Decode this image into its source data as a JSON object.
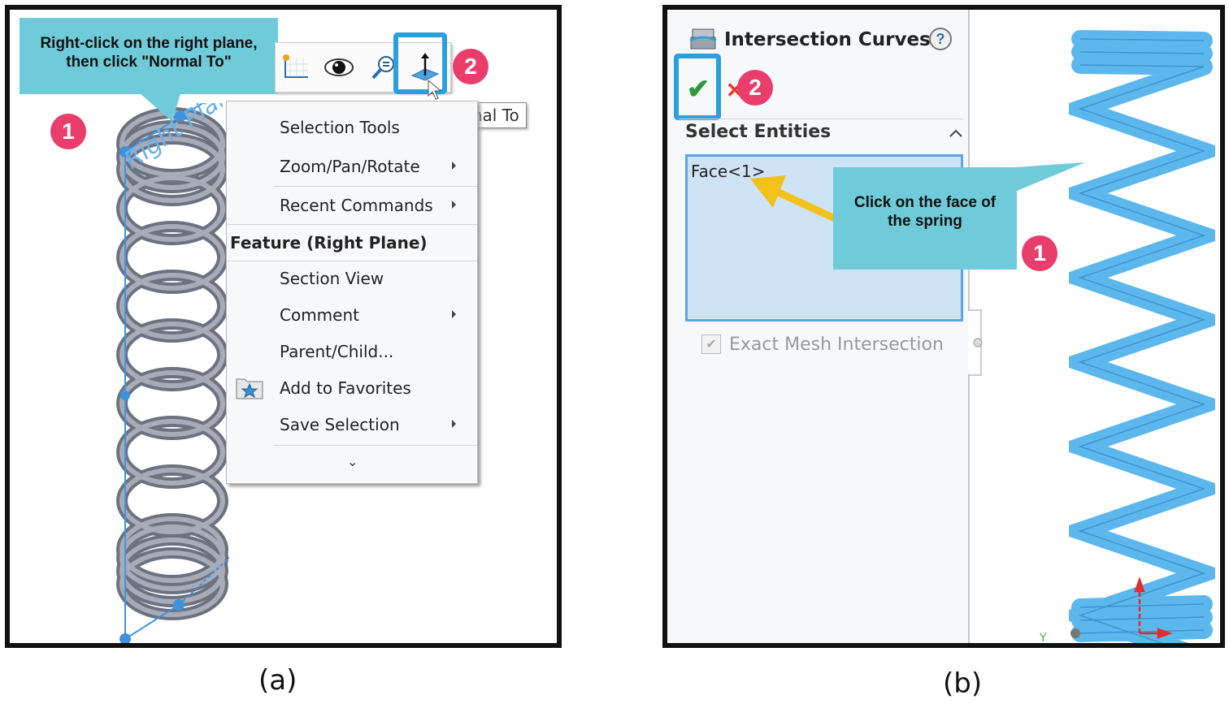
{
  "panel_a": {
    "callout": "Right-click on the right plane, then click \"Normal To\"",
    "badge_1": "1",
    "badge_2": "2",
    "plane_label": "Right Plane",
    "toolbar": {
      "icons": [
        "sketch-grid-icon",
        "eye-icon",
        "zoom-to-selection-icon",
        "normal-to-icon"
      ]
    },
    "tooltip": "Normal To",
    "context_menu": {
      "items": [
        {
          "label": "Selection Tools",
          "submenu": false
        },
        {
          "label": "Zoom/Pan/Rotate",
          "submenu": true
        },
        {
          "label": "Recent Commands",
          "submenu": true
        },
        {
          "label": "Feature (Right Plane)",
          "header": true
        },
        {
          "label": "Section View",
          "submenu": false
        },
        {
          "label": "Comment",
          "submenu": true
        },
        {
          "label": "Parent/Child...",
          "submenu": false
        },
        {
          "label": "Add to Favorites",
          "submenu": false,
          "icon": "favorites-star-folder-icon"
        },
        {
          "label": "Save Selection",
          "submenu": true
        }
      ],
      "expand_glyph": "⌄"
    },
    "caption": "(a)"
  },
  "panel_b": {
    "property_manager": {
      "title": "Intersection Curves",
      "help_glyph": "?",
      "ok_glyph": "✔",
      "cancel_glyph": "✕",
      "section_title": "Select Entities",
      "selection_value": "Face<1>",
      "checkbox_label": "Exact Mesh Intersection",
      "checkbox_checked": true
    },
    "callout": "Click on the face of the spring",
    "badge_1": "1",
    "badge_2": "2",
    "axis_label": "Y",
    "caption": "(b)"
  },
  "colors": {
    "callout": "#6fcbd9",
    "badge": "#e93e6b",
    "highlight": "#2aa0dc",
    "spring_gray": "#8a8f9c",
    "spring_blue": "#5cb8ec",
    "arrow_yellow": "#f2c21b",
    "ok_green": "#2e9a3a",
    "cancel_red": "#e53b2a"
  }
}
